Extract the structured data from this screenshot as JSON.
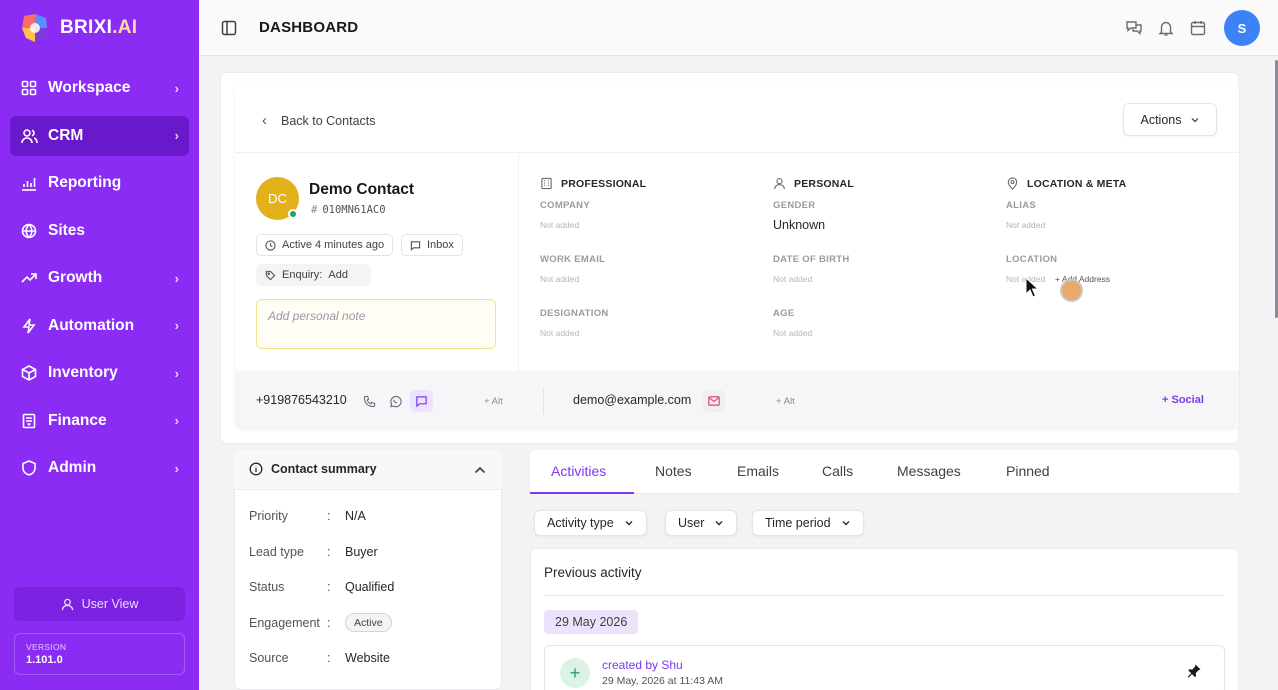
{
  "brand": {
    "name": "BRIXI",
    "suffix": ".AI"
  },
  "sidebar": {
    "items": [
      {
        "label": "Workspace",
        "icon": "grid-icon",
        "chevron": true,
        "active": false
      },
      {
        "label": "CRM",
        "icon": "users-icon",
        "chevron": true,
        "active": true
      },
      {
        "label": "Reporting",
        "icon": "bar-chart-icon",
        "chevron": false,
        "active": false
      },
      {
        "label": "Sites",
        "icon": "globe-icon",
        "chevron": false,
        "active": false
      },
      {
        "label": "Growth",
        "icon": "trending-up-icon",
        "chevron": true,
        "active": false
      },
      {
        "label": "Automation",
        "icon": "bolt-icon",
        "chevron": true,
        "active": false
      },
      {
        "label": "Inventory",
        "icon": "box-icon",
        "chevron": true,
        "active": false
      },
      {
        "label": "Finance",
        "icon": "receipt-icon",
        "chevron": true,
        "active": false
      },
      {
        "label": "Admin",
        "icon": "shield-icon",
        "chevron": true,
        "active": false
      }
    ],
    "user_view": "User View",
    "version_label": "VERSION",
    "version_value": "1.101.0"
  },
  "topbar": {
    "title": "DASHBOARD",
    "avatar": "S"
  },
  "contact": {
    "back_label": "Back to Contacts",
    "actions_label": "Actions",
    "initials": "DC",
    "name": "Demo Contact",
    "id": "010MN61AC0",
    "active": "Active 4 minutes ago",
    "inbox": "Inbox",
    "enquiry_label": "Enquiry:",
    "enquiry_add": "Add",
    "note_placeholder": "Add personal note"
  },
  "sections": {
    "professional": {
      "title": "PROFESSIONAL",
      "company_label": "COMPANY",
      "company_value": "Not added",
      "work_email_label": "WORK EMAIL",
      "work_email_value": "Not added",
      "designation_label": "DESIGNATION",
      "designation_value": "Not added"
    },
    "personal": {
      "title": "PERSONAL",
      "gender_label": "GENDER",
      "gender_value": "Unknown",
      "dob_label": "DATE OF BIRTH",
      "dob_value": "Not added",
      "age_label": "AGE",
      "age_value": "Not added"
    },
    "location": {
      "title": "LOCATION & META",
      "alias_label": "ALIAS",
      "alias_value": "Not added",
      "location_label": "LOCATION",
      "location_value": "Not added",
      "add_address": "+ Add Address"
    }
  },
  "contact_bar": {
    "phone": "+919876543210",
    "phone_alt": "+ Alt",
    "email": "demo@example.com",
    "email_alt": "+ Alt",
    "social": "+ Social"
  },
  "summary": {
    "title": "Contact summary",
    "rows": [
      {
        "key": "Priority",
        "value": "N/A"
      },
      {
        "key": "Lead type",
        "value": "Buyer"
      },
      {
        "key": "Status",
        "value": "Qualified"
      },
      {
        "key": "Engagement",
        "value": "Active"
      },
      {
        "key": "Source",
        "value": "Website"
      }
    ]
  },
  "tabs": [
    "Activities",
    "Notes",
    "Emails",
    "Calls",
    "Messages",
    "Pinned"
  ],
  "filters": [
    "Activity type",
    "User",
    "Time period"
  ],
  "activity": {
    "section_title": "Previous activity",
    "date": "29 May 2026",
    "item_title": "created by Shu",
    "item_time": "29 May, 2026 at 11:43 AM"
  },
  "colors": {
    "sidebar": "#8b2cf5",
    "accent": "#7c3aed",
    "avatar": "#e3b21a"
  }
}
